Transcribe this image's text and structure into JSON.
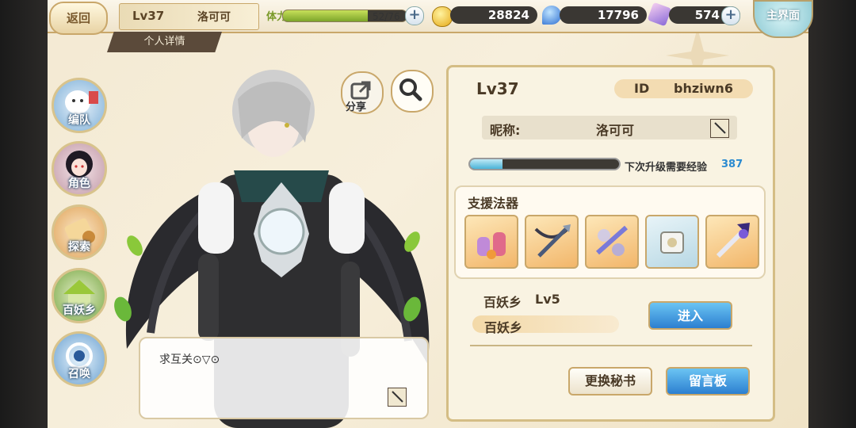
{
  "header": {
    "back_label": "返回",
    "level": "Lv37",
    "player_name": "洛可可",
    "subtab": "个人详情",
    "stamina_label": "体力",
    "stamina_text": "52/76",
    "stamina_fraction": 0.684,
    "gold": "28824",
    "soul": "17796",
    "gems": "574",
    "main_label": "主界面"
  },
  "nav": {
    "items": [
      {
        "label": "编队"
      },
      {
        "label": "角色"
      },
      {
        "label": "探索"
      },
      {
        "label": "百妖乡"
      },
      {
        "label": "召唤"
      }
    ]
  },
  "character": {
    "share_label": "分享",
    "bubble_text": "求互关⊙▽⊙"
  },
  "profile": {
    "level": "Lv37",
    "id_label": "ID",
    "id_value": "bhziwn6",
    "nickname_label": "昵称:",
    "nickname": "洛可可",
    "exp_fraction": 0.22,
    "exp_label": "下次升级需要经验",
    "exp_value": "387",
    "support_title": "支援法器",
    "village_name": "百妖乡",
    "village_level": "Lv5",
    "village_bar_text": "百妖乡",
    "enter_label": "进入",
    "secretary_label": "更换秘书",
    "message_label": "留言板"
  }
}
